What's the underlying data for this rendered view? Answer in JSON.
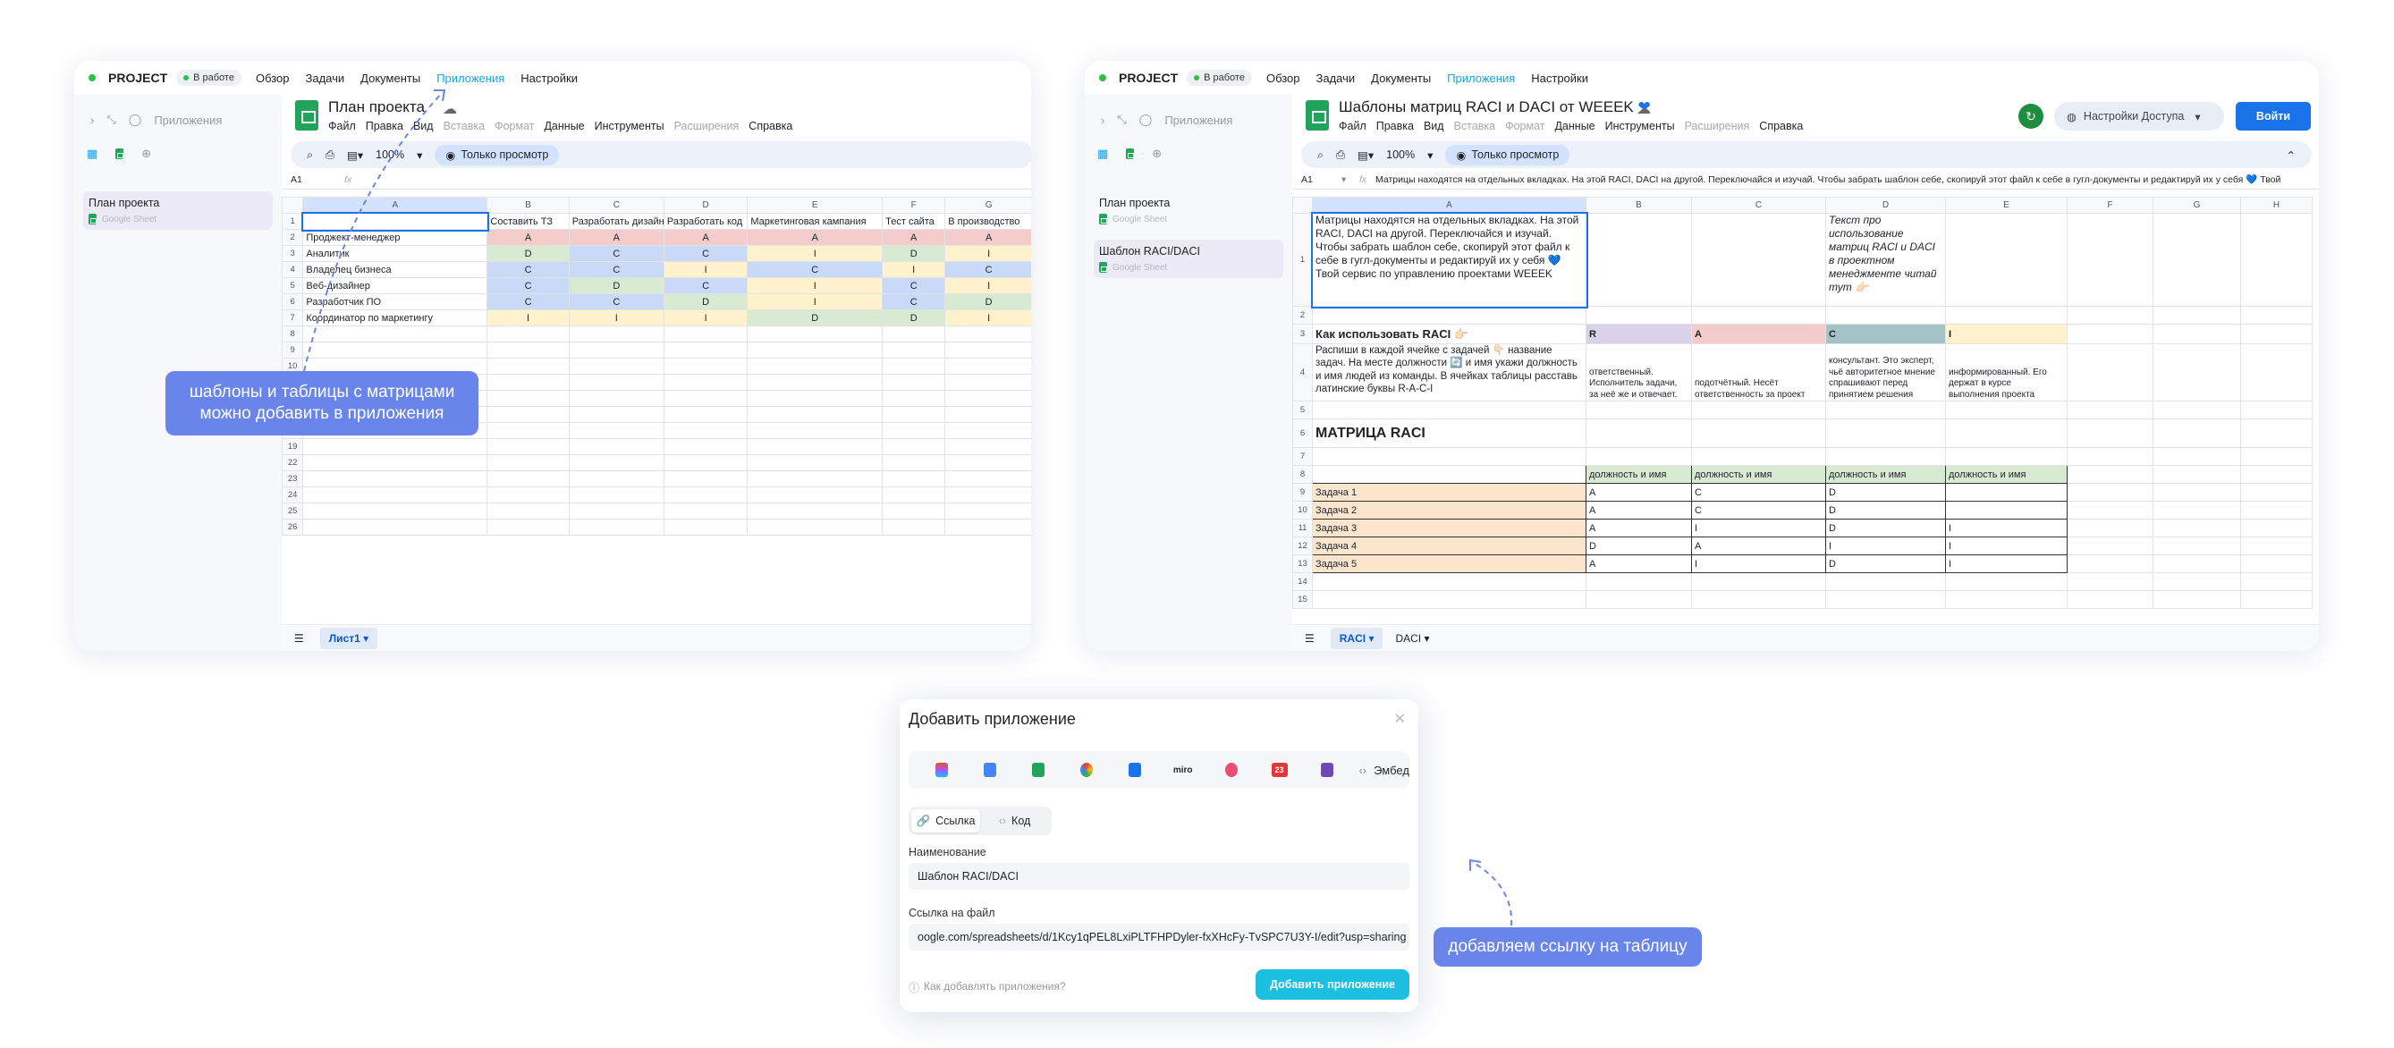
{
  "colors": {
    "accent": "#1aa1e6",
    "callout": "#6a85ea",
    "add_button": "#1cbfe0",
    "status_dot": "#2fbf4b",
    "blue_button": "#1a73e8"
  },
  "app": {
    "project": "PROJECT",
    "status": "В работе",
    "nav": [
      "Обзор",
      "Задачи",
      "Документы",
      "Приложения",
      "Настройки"
    ],
    "apps_label": "Приложения"
  },
  "left": {
    "sidebar": [
      {
        "label": "План проекта",
        "sub": "Google Sheet"
      }
    ],
    "sheet": {
      "title": "План проекта",
      "menu": [
        "Файл",
        "Правка",
        "Вид",
        "Вставка",
        "Формат",
        "Данные",
        "Инструменты",
        "Расширения",
        "Справка"
      ],
      "zoom": "100%",
      "view": "Только просмотр",
      "cellref": "A1",
      "fx": "fx",
      "cols": [
        "A",
        "B",
        "C",
        "D",
        "E",
        "F",
        "G"
      ],
      "header": [
        "Составить ТЗ",
        "Разработать дизайн",
        "Разработать код",
        "Маркетинговая кампания",
        "Тест сайта",
        "В производство"
      ],
      "rows": [
        {
          "role": "Проджект-менеджер",
          "v": [
            "A",
            "A",
            "A",
            "A",
            "A",
            "A"
          ],
          "c": [
            "pk",
            "pk",
            "pk",
            "pk",
            "pk",
            "pk"
          ]
        },
        {
          "role": "Аналитик",
          "v": [
            "D",
            "C",
            "C",
            "I",
            "D",
            "I"
          ],
          "c": [
            "gr",
            "bl",
            "bl",
            "yl",
            "gr",
            "yl"
          ]
        },
        {
          "role": "Владелец бизнеса",
          "v": [
            "C",
            "C",
            "I",
            "C",
            "I",
            "C"
          ],
          "c": [
            "bl",
            "bl",
            "yl",
            "bl",
            "yl",
            "bl"
          ]
        },
        {
          "role": "Веб-дизайнер",
          "v": [
            "C",
            "D",
            "C",
            "I",
            "C",
            "I"
          ],
          "c": [
            "bl",
            "gr",
            "bl",
            "yl",
            "bl",
            "yl"
          ]
        },
        {
          "role": "Разработчик ПО",
          "v": [
            "C",
            "C",
            "D",
            "I",
            "C",
            "D"
          ],
          "c": [
            "bl",
            "bl",
            "gr",
            "yl",
            "bl",
            "gr"
          ]
        },
        {
          "role": "Координатор по маркетингу",
          "v": [
            "I",
            "I",
            "I",
            "D",
            "D",
            "I"
          ],
          "c": [
            "yl",
            "yl",
            "yl",
            "gr",
            "gr",
            "yl"
          ]
        }
      ],
      "row_numbers": [
        "1",
        "2",
        "3",
        "4",
        "5",
        "6",
        "7",
        "8",
        "9",
        "10",
        "15",
        "16",
        "17",
        "18",
        "19",
        "22",
        "23",
        "24",
        "25",
        "26"
      ],
      "tab": "Лист1"
    }
  },
  "right": {
    "sidebar": [
      {
        "label": "План проекта",
        "sub": "Google Sheet"
      },
      {
        "label": "Шаблон RACI/DACI",
        "sub": "Google Sheet"
      }
    ],
    "sheet": {
      "title": "Шаблоны матриц RACI и DACI от WEEEK",
      "menu": [
        "Файл",
        "Правка",
        "Вид",
        "Вставка",
        "Формат",
        "Данные",
        "Инструменты",
        "Расширения",
        "Справка"
      ],
      "access": "Настройки Доступа",
      "login": "Войти",
      "zoom": "100%",
      "view": "Только просмотр",
      "cellref": "A1",
      "formula": "Матрицы находятся на отдельных вкладках. На этой RACI, DACI на другой. Переключайся и изучай. Чтобы забрать шаблон себе, скопируй этот файл к себе в гугл-документы и редактируй их у себя 💙 Твой",
      "cols": [
        "A",
        "B",
        "C",
        "D",
        "E",
        "F",
        "G",
        "H"
      ],
      "a1": "Матрицы находятся на отдельных вкладках. На этой RACI, DACI на другой. Переключайся и изучай. Чтобы забрать шаблон себе, скопируй этот файл к себе в гугл-документы и редактируй их у себя 💙 Твой сервис по управлению проектами WEEEK",
      "d1": "Текст про использование матриц RACI и DACI в проектном менеджменте читай тут 👉🏻",
      "how_title": "Как использовать RACI 👉🏻",
      "letters": [
        "R",
        "A",
        "C",
        "I"
      ],
      "how_text": "Распиши в каждой ячейке с задачей 👇🏻 название задач. На месте должности 🔄 и имя укажи должность и имя людей из команды. В ячейках таблицы расставь латинские буквы R-A-C-I",
      "defs": [
        "ответственный. Исполнитель задачи, за неё же и отвечает.",
        "подотчётный. Несёт ответственность за проект",
        "консультант. Это эксперт, чьё авторитетное мнение спрашивают перед принятием решения",
        "информированный. Его держат в курсе выполнения проекта"
      ],
      "matrix_title": "МАТРИЦА RACI",
      "role_header": "должность и имя",
      "tasks": [
        {
          "name": "Задача 1",
          "v": [
            "A",
            "C",
            "D",
            ""
          ]
        },
        {
          "name": "Задача 2",
          "v": [
            "A",
            "C",
            "D",
            ""
          ]
        },
        {
          "name": "Задача 3",
          "v": [
            "A",
            "I",
            "D",
            "I"
          ]
        },
        {
          "name": "Задача 4",
          "v": [
            "D",
            "A",
            "I",
            "I"
          ]
        },
        {
          "name": "Задача 5",
          "v": [
            "A",
            "I",
            "D",
            "I"
          ]
        }
      ],
      "row_numbers": [
        "1",
        "2",
        "3",
        "4",
        "5",
        "6",
        "7",
        "8",
        "9",
        "10",
        "11",
        "12",
        "13",
        "14",
        "15"
      ],
      "tabs": [
        "RACI",
        "DACI"
      ]
    }
  },
  "dialog": {
    "title": "Добавить приложение",
    "embed": "Эмбед",
    "miro": "miro",
    "cal_day": "23",
    "seg": [
      "Ссылка",
      "Код"
    ],
    "name_label": "Наименование",
    "name_value": "Шаблон RACI/DACI",
    "link_label": "Ссылка на файл",
    "link_value": "oogle.com/spreadsheets/d/1Kcy1qPEL8LxiPLTFHPDyler-fxXHcFy-TvSPC7U3Y-I/edit?usp=sharing",
    "help": "Как добавлять приложения?",
    "add": "Добавить приложение"
  },
  "callouts": {
    "left": "шаблоны и таблицы с матрицами можно добавить в приложения",
    "bottom": "добавляем ссылку на таблицу"
  }
}
